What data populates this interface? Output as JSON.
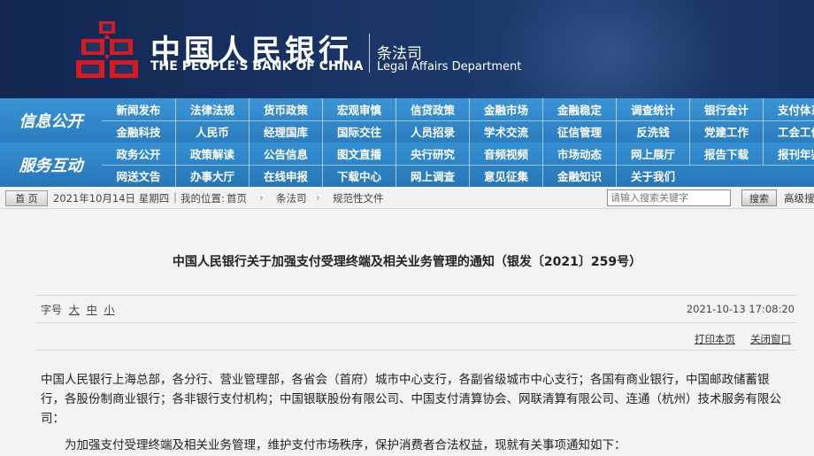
{
  "header": {
    "bank_name_cn": "中国人民银行",
    "bank_name_en": "THE PEOPLE'S BANK OF CHINA",
    "dept_cn": "条法司",
    "dept_en": "Legal Affairs Department",
    "logo_icon": "pboc-logo-icon"
  },
  "nav": {
    "sections": [
      {
        "label": "信息公开",
        "rows": [
          [
            "新闻发布",
            "法律法规",
            "货币政策",
            "宏观审慎",
            "信贷政策",
            "金融市场",
            "金融稳定",
            "调查统计",
            "银行会计",
            "支付体系"
          ],
          [
            "金融科技",
            "人民币",
            "经理国库",
            "国际交往",
            "人员招录",
            "学术交流",
            "征信管理",
            "反洗钱",
            "党建工作",
            "工会工作"
          ]
        ]
      },
      {
        "label": "服务互动",
        "rows": [
          [
            "政务公开",
            "政策解读",
            "公告信息",
            "图文直播",
            "央行研究",
            "音频视频",
            "市场动态",
            "网上展厅",
            "报告下载",
            "报刊年鉴"
          ],
          [
            "网送文告",
            "办事大厅",
            "在线申报",
            "下载中心",
            "网上调查",
            "意见征集",
            "金融知识",
            "关于我们"
          ]
        ]
      }
    ]
  },
  "breadcrumb": {
    "home_label": "首 页",
    "date_text": "2021年10月14日  星期四",
    "location_label": "我的位置:",
    "items": [
      "首页",
      "条法司",
      "规范性文件"
    ],
    "search_placeholder": "请输入搜索关键字",
    "search_button": "搜索",
    "advanced_search": "高级搜索"
  },
  "article": {
    "title": "中国人民银行关于加强支付受理终端及相关业务管理的通知（银发〔2021〕259号）",
    "font_size_label": "字号",
    "font_sizes": [
      "大",
      "中",
      "小"
    ],
    "date": "2021-10-13 17:08:20",
    "print_label": "打印本页",
    "close_label": "关闭窗口",
    "paragraph1": "中国人民银行上海总部，各分行、营业管理部，各省会（首府）城市中心支行，各副省级城市中心支行；各国有商业银行，中国邮政储蓄银行，各股份制商业银行；各非银行支付机构；中国银联股份有限公司、中国支付清算协会、网联清算有限公司、连通（杭州）技术服务有限公司：",
    "paragraph2": "为加强支付受理终端及相关业务管理，维护支付市场秩序，保护消费者合法权益，现就有关事项通知如下："
  },
  "colors": {
    "header_bg": "#1a3566",
    "nav_bg": "#2a7dbe",
    "logo_red": "#d71920"
  }
}
